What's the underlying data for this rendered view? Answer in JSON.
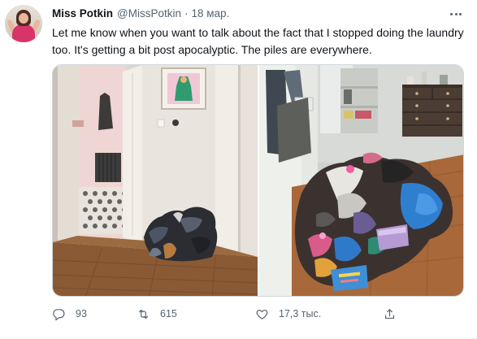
{
  "tweet": {
    "display_name": "Miss Potkin",
    "handle": "@MissPotkin",
    "separator": "·",
    "time": "18 мар.",
    "text": "Let me know when you want to talk about the fact that I stopped doing the laundry too. It's getting a bit post apocalyptic. The piles are everywhere.",
    "media": [
      {
        "icon": "photo-hallway-laundry-pile"
      },
      {
        "icon": "photo-bedroom-laundry-piles"
      }
    ],
    "actions": {
      "reply_count": "93",
      "retweet_count": "615",
      "like_count": "17,3 тыс.",
      "share_count": ""
    }
  },
  "colors": {
    "text_primary": "#0f1419",
    "text_secondary": "#536471",
    "border": "#cfd9de"
  },
  "icons": [
    "more-icon",
    "reply-icon",
    "retweet-icon",
    "like-icon",
    "share-icon"
  ]
}
